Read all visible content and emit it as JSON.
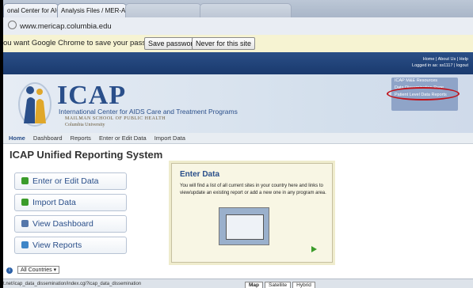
{
  "tabs": [
    {
      "label": "onal Center for AIC",
      "active": true
    },
    {
      "label": "Analysis Files / MER-ALL W",
      "active": false
    },
    {
      "label": "",
      "active": false
    },
    {
      "label": "",
      "active": false
    }
  ],
  "address": {
    "url": "www.mericap.columbia.edu"
  },
  "infobar": {
    "message": "ou want Google Chrome to save your password?",
    "save_label": "Save password",
    "never_label": "Never for this site"
  },
  "header": {
    "top_links": "Home  |  About Us  |  Help",
    "logged_in": "Logged in as: ss1117  |  logout"
  },
  "brand": {
    "title": "ICAP",
    "subtitle": "International Center for AIDS Care and Treatment Programs",
    "school": "MAILMAN SCHOOL OF PUBLIC HEALTH",
    "university": "Columbia University"
  },
  "side_links": [
    "ICAP M&E Resources",
    "Data Dissemination Page",
    "Patient Level Data Reports"
  ],
  "menu": [
    "Home",
    "Dashboard",
    "Reports",
    "Enter or Edit Data",
    "Import Data"
  ],
  "page_title": "ICAP Unified Reporting System",
  "nav_buttons": [
    {
      "label": "Enter or Edit Data",
      "color": "#3b9c2a"
    },
    {
      "label": "Import Data",
      "color": "#3b9c2a"
    },
    {
      "label": "View Dashboard",
      "color": "#5577aa"
    },
    {
      "label": "View Reports",
      "color": "#3f86c8"
    }
  ],
  "enter_panel": {
    "heading": "Enter Data",
    "description": "You will find a list of all current sites in your country here and links to view/update an existing report or add a new one in any program area."
  },
  "countries": {
    "selected": "All Countries"
  },
  "status_bar": "t.net/icap_data_dissemination/index.cgi?icap_data_dissemination",
  "map_buttons": [
    "Map",
    "Satellite",
    "Hybrid"
  ],
  "colors": {
    "brand_blue": "#2a4f8a",
    "navy": "#1a3a6e",
    "highlight_red": "#c0141c",
    "arrow_green": "#3b9c2a"
  }
}
